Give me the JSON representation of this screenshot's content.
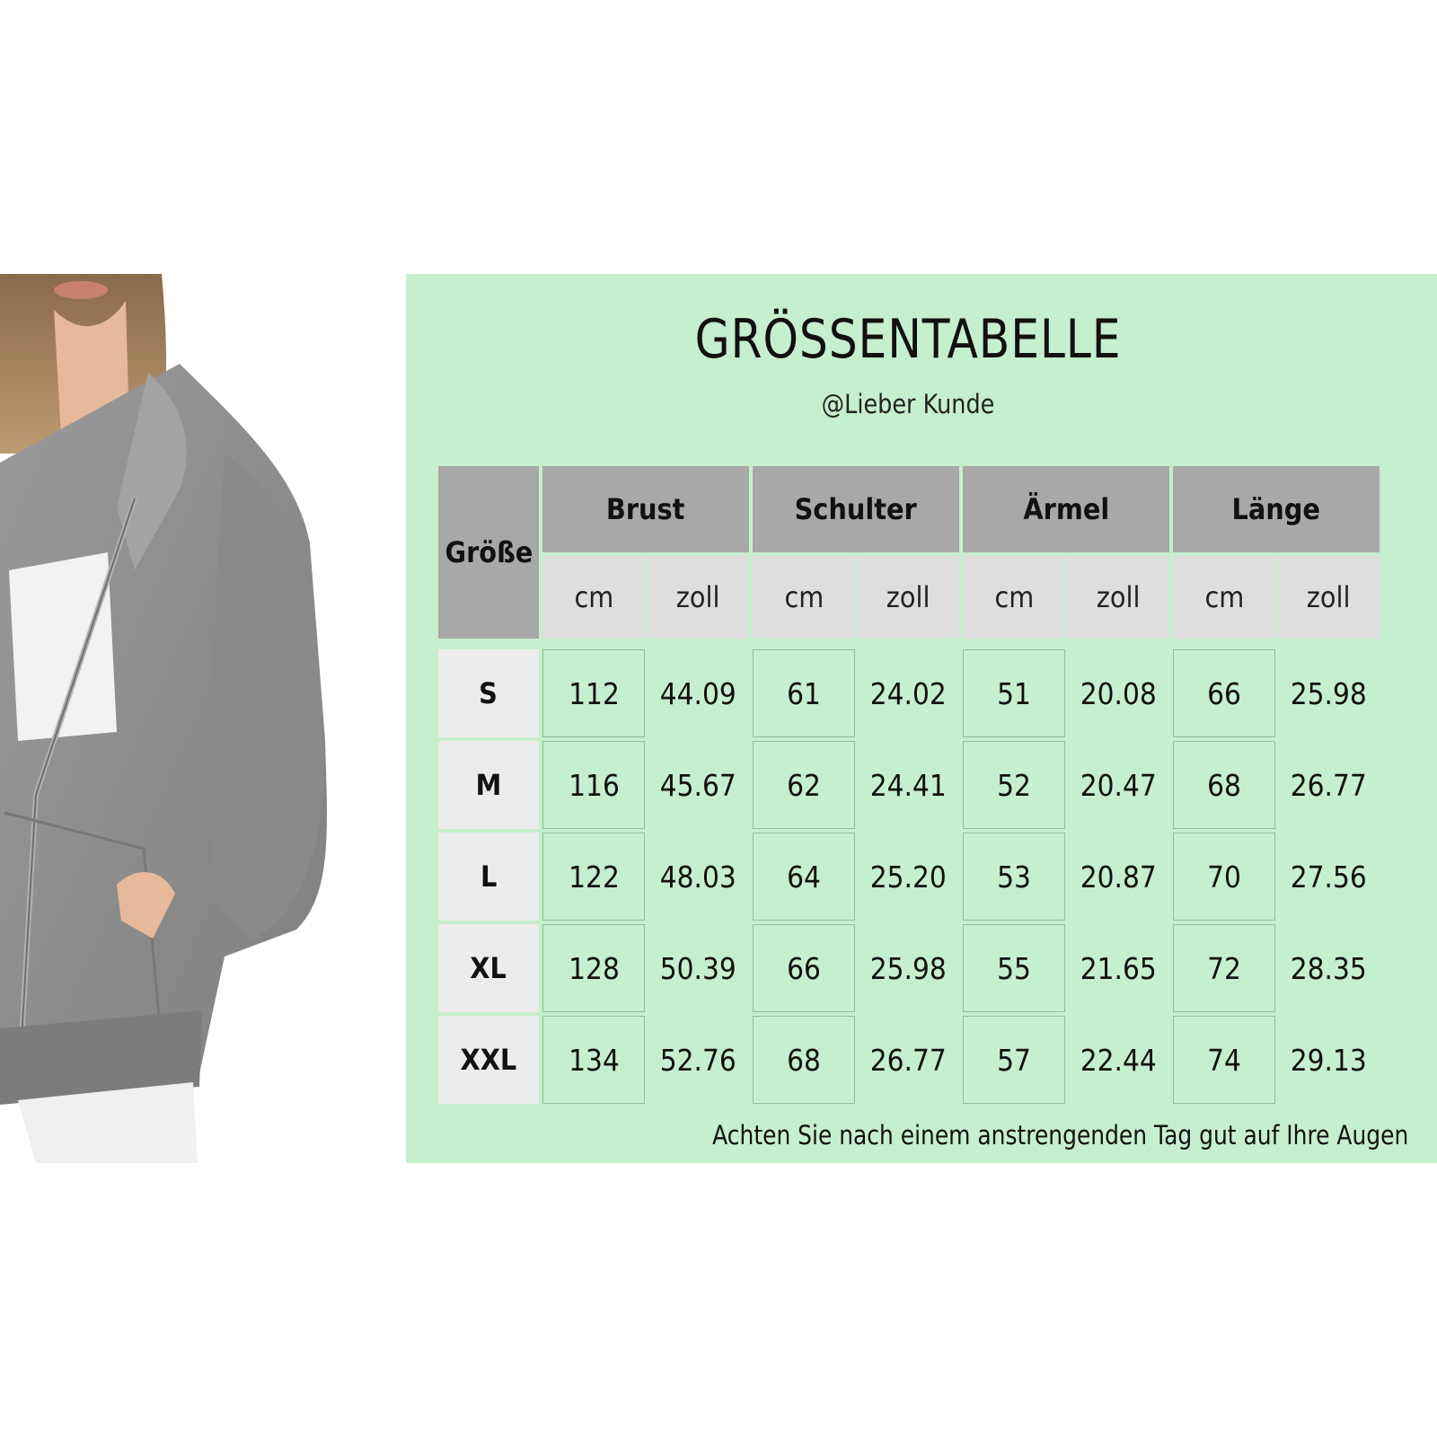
{
  "title": "GRÖSSENTABELLE",
  "subtitle": "@Lieber Kunde",
  "table": {
    "size_header": "Größe",
    "groups": [
      "Brust",
      "Schulter",
      "Ärmel",
      "Länge"
    ],
    "units": [
      "cm",
      "zoll",
      "cm",
      "zoll",
      "cm",
      "zoll",
      "cm",
      "zoll"
    ],
    "rows": [
      {
        "size": "S",
        "values": [
          "112",
          "44.09",
          "61",
          "24.02",
          "51",
          "20.08",
          "66",
          "25.98"
        ]
      },
      {
        "size": "M",
        "values": [
          "116",
          "45.67",
          "62",
          "24.41",
          "52",
          "20.47",
          "68",
          "26.77"
        ]
      },
      {
        "size": "L",
        "values": [
          "122",
          "48.03",
          "64",
          "25.20",
          "53",
          "20.87",
          "70",
          "27.56"
        ]
      },
      {
        "size": "XL",
        "values": [
          "128",
          "50.39",
          "66",
          "25.98",
          "55",
          "21.65",
          "72",
          "28.35"
        ]
      },
      {
        "size": "XXL",
        "values": [
          "134",
          "52.76",
          "68",
          "26.77",
          "57",
          "22.44",
          "74",
          "29.13"
        ]
      }
    ]
  },
  "footnote": "Achten Sie nach einem anstrengenden Tag gut auf Ihre Augen",
  "colors": {
    "panel": "#c6efcf",
    "header": "#a8a8a8",
    "unit_row": "#dedede",
    "size_col": "#ececec",
    "sweater": "#8e8e8e"
  }
}
